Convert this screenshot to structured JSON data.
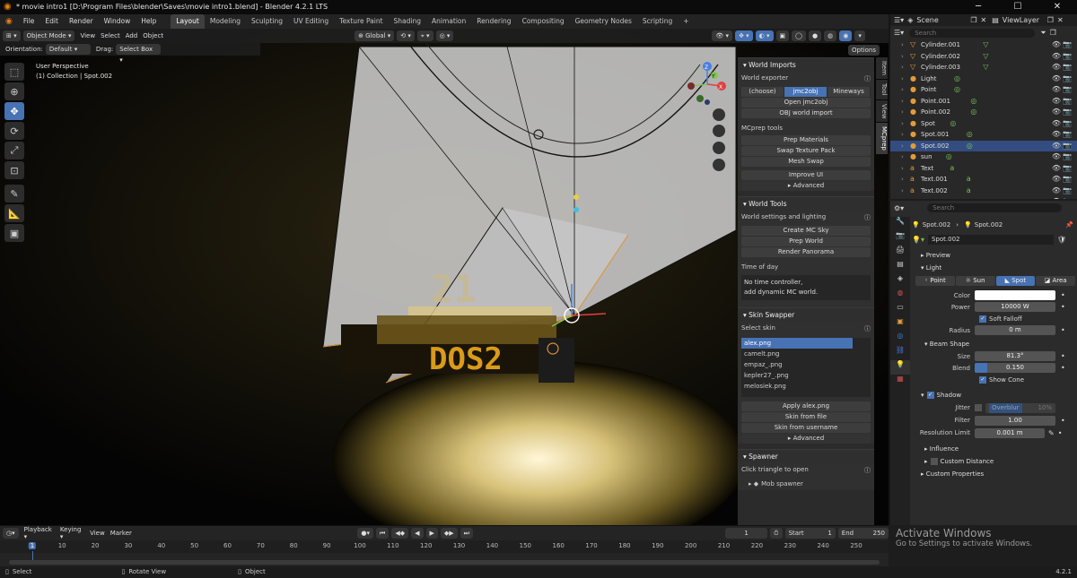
{
  "titlebar": {
    "title": "* movie intro1 [D:\\Program Files\\blender\\Saves\\movie intro1.blend] - Blender 4.2.1 LTS"
  },
  "menu": [
    "File",
    "Edit",
    "Render",
    "Window",
    "Help"
  ],
  "workspaces": [
    "Layout",
    "Modeling",
    "Sculpting",
    "UV Editing",
    "Texture Paint",
    "Shading",
    "Animation",
    "Rendering",
    "Compositing",
    "Geometry Nodes",
    "Scripting"
  ],
  "scene": {
    "name": "Scene",
    "viewlayer": "ViewLayer"
  },
  "viewport": {
    "mode": "Object Mode",
    "menus": [
      "View",
      "Select",
      "Add",
      "Object"
    ],
    "transform": "Global",
    "options": "Options",
    "orientation_label": "Orientation:",
    "orientation_value": "Default",
    "drag_label": "Drag:",
    "drag_value": "Select Box",
    "info_line1": "User Perspective",
    "info_line2": "(1) Collection | Spot.002",
    "gizmo_labels": {
      "z": "Z",
      "x": "X",
      "y": "Y"
    },
    "scene_text_top": "21",
    "scene_text_bottom": "DOS2"
  },
  "npanel": {
    "tabs": [
      "Item",
      "Tool",
      "View",
      "MCprep"
    ],
    "world_imports": {
      "title": "World Imports",
      "exporter_label": "World exporter",
      "exporter_options": [
        "(choose)",
        "jmc2obj",
        "Mineways"
      ],
      "open_btn": "Open jmc2obj",
      "obj_btn": "OBJ world import",
      "tools_label": "MCprep tools",
      "prep_materials": "Prep Materials",
      "swap_texture": "Swap Texture Pack",
      "mesh_swap": "Mesh Swap",
      "improve_ui": "Improve UI",
      "advanced": "Advanced"
    },
    "world_tools": {
      "title": "World Tools",
      "settings_label": "World settings and lighting",
      "create_sky": "Create MC Sky",
      "prep_world": "Prep World",
      "render_panorama": "Render Panorama",
      "time_label": "Time of day",
      "note_line1": "No time controller,",
      "note_line2": "add dynamic MC world."
    },
    "skin_swapper": {
      "title": "Skin Swapper",
      "select_label": "Select skin",
      "skins": [
        "alex.png",
        "camelt.png",
        "empaz_.png",
        "kepler27_.png",
        "melosiek.png"
      ],
      "apply_btn": "Apply alex.png",
      "from_file": "Skin from file",
      "from_username": "Skin from username",
      "advanced": "Advanced"
    },
    "spawner": {
      "title": "Spawner",
      "hint": "Click triangle to open",
      "mob_spawner": "Mob spawner"
    }
  },
  "outliner": {
    "search_placeholder": "Search",
    "items": [
      {
        "name": "Cylinder.001",
        "type": "mesh"
      },
      {
        "name": "Cylinder.002",
        "type": "mesh"
      },
      {
        "name": "Cylinder.003",
        "type": "mesh"
      },
      {
        "name": "Light",
        "type": "light"
      },
      {
        "name": "Point",
        "type": "light"
      },
      {
        "name": "Point.001",
        "type": "light"
      },
      {
        "name": "Point.002",
        "type": "light"
      },
      {
        "name": "Spot",
        "type": "light"
      },
      {
        "name": "Spot.001",
        "type": "light"
      },
      {
        "name": "Spot.002",
        "type": "light",
        "selected": true
      },
      {
        "name": "sun",
        "type": "light"
      },
      {
        "name": "Text",
        "type": "text"
      },
      {
        "name": "Text.001",
        "type": "text"
      },
      {
        "name": "Text.002",
        "type": "text"
      },
      {
        "name": "Text.003",
        "type": "text"
      }
    ]
  },
  "properties": {
    "search_placeholder": "Search",
    "breadcrumb_obj": "Spot.002",
    "breadcrumb_data": "Spot.002",
    "datablock": "Spot.002",
    "preview": "Preview",
    "light": "Light",
    "light_types": [
      "Point",
      "Sun",
      "Spot",
      "Area"
    ],
    "color_label": "Color",
    "power_label": "Power",
    "power_value": "10000 W",
    "soft_falloff": "Soft Falloff",
    "radius_label": "Radius",
    "radius_value": "0 m",
    "beam_shape": "Beam Shape",
    "size_label": "Size",
    "size_value": "81.3°",
    "blend_label": "Blend",
    "blend_value": "0.150",
    "blend_fraction": 0.15,
    "show_cone": "Show Cone",
    "shadow": "Shadow",
    "jitter_label": "Jitter",
    "overblur_label": "Overblur",
    "overblur_value": "10%",
    "filter_label": "Filter",
    "filter_value": "1.00",
    "res_limit_label": "Resolution Limit",
    "res_limit_value": "0.001 m",
    "influence": "Influence",
    "custom_distance": "Custom Distance",
    "custom_properties": "Custom Properties",
    "light_color": "#ffffff"
  },
  "timeline": {
    "menus": [
      "Playback",
      "Keying",
      "View",
      "Marker"
    ],
    "current_frame": "1",
    "start_label": "Start",
    "start_value": "1",
    "end_label": "End",
    "end_value": "250",
    "ticks": [
      "1",
      "10",
      "20",
      "30",
      "40",
      "50",
      "60",
      "70",
      "80",
      "90",
      "100",
      "110",
      "120",
      "130",
      "140",
      "150",
      "160",
      "170",
      "180",
      "190",
      "200",
      "210",
      "220",
      "230",
      "240",
      "250"
    ]
  },
  "statusbar": {
    "select": "Select",
    "rotate": "Rotate View",
    "object": "Object",
    "version": "4.2.1"
  },
  "watermark": {
    "line1": "Activate Windows",
    "line2": "Go to Settings to activate Windows."
  },
  "colors": {
    "accent": "#4772b3",
    "selection": "#334d80",
    "light_icon": "#e39b3a",
    "mesh_icon": "#77c25a"
  }
}
